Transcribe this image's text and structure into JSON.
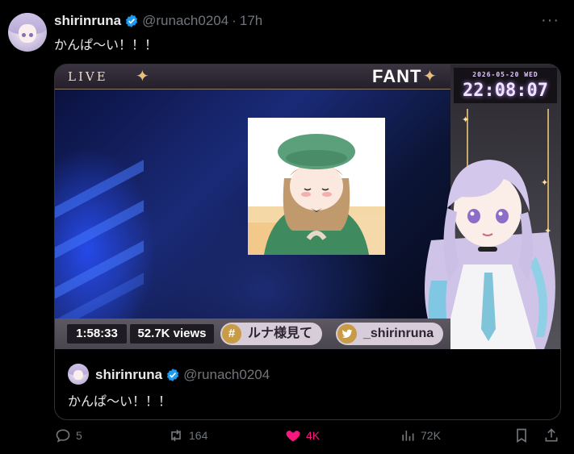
{
  "tweet": {
    "display_name": "shirinruna",
    "handle": "@runach0204",
    "separator": "·",
    "time": "17h",
    "more": "···",
    "text": "かんぱ〜い！！！"
  },
  "media": {
    "live_label": "LIVE",
    "stream_title": "FANT",
    "clock_date": "2026-05-20 WED",
    "clock_time": "22:08:07",
    "timer": "1:58:33",
    "views": "52.7K views",
    "hashtag_icon": "#",
    "hashtag": "ルナ様見て",
    "twitter_handle": "_shirinruna"
  },
  "quoted": {
    "display_name": "shirinruna",
    "handle": "@runach0204",
    "text": "かんぱ〜い！！！"
  },
  "actions": {
    "replies": "5",
    "reposts": "164",
    "likes": "4K",
    "views": "72K"
  },
  "colors": {
    "verified": "#1d9bf0",
    "like": "#f91880",
    "muted": "#71767b"
  },
  "icons": [
    "verified-badge-icon",
    "more-icon",
    "reply-icon",
    "repost-icon",
    "heart-icon",
    "views-icon",
    "bookmark-icon",
    "share-icon",
    "twitter-bird-icon"
  ]
}
